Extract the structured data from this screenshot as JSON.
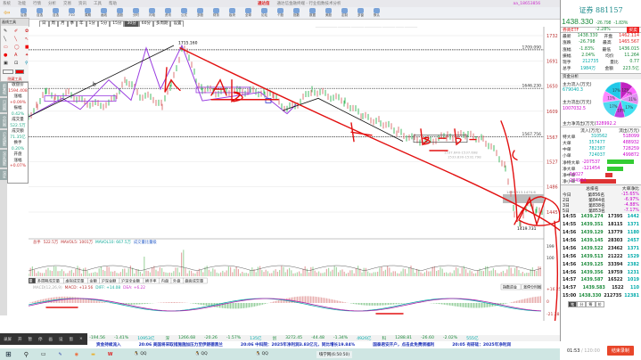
{
  "titlebar": {
    "menus": [
      "系统",
      "功能",
      "行情",
      "分析",
      "交易",
      "资讯",
      "工具",
      "帮助"
    ],
    "brand": "通达信",
    "app_title": "通达信金融终端 - 行业指数技术分析",
    "user": "aa_18653856"
  },
  "toolbar": {
    "items": [
      "后退",
      "自选",
      "自选",
      "F10",
      "周期",
      "画线",
      "选股",
      "分时",
      "闪电",
      "资讯",
      "公式",
      "多股",
      "财务",
      "板块",
      "全球",
      "论坛",
      "个股",
      "指数",
      "数据",
      "美股",
      "定制",
      "多窗",
      "默认"
    ]
  },
  "drawing_tools": {
    "title": "画线工具",
    "footer": "隐藏工具"
  },
  "period_bar": {
    "items": [
      "日",
      "周",
      "月",
      "季",
      "年",
      "1分",
      "5分",
      "15分",
      "30分",
      "60分",
      "多周期",
      "设置"
    ],
    "active": "30分"
  },
  "vertical_tabs": [
    "前复权",
    "日线图",
    "分时图",
    "沪深指数",
    "深证指数",
    "深证"
  ],
  "stats": [
    {
      "label": "收盘价",
      "value": "1594.408"
    },
    {
      "label": "涨幅",
      "value": "+0.09%"
    },
    {
      "label": "振幅",
      "value": "0.42%"
    },
    {
      "label": "成交量",
      "value": "522.5万"
    },
    {
      "label": "成交额",
      "value": "71.35亿"
    },
    {
      "label": "换手",
      "value": "0.20%"
    },
    {
      "label": "开盘",
      "value": ""
    },
    {
      "label": "涨幅",
      "value": "+0.07%"
    }
  ],
  "chart": {
    "top_buttons": [
      "龙头回溯",
      "九转",
      "事件",
      "翻倍选",
      "历K",
      "画",
      "◀▶"
    ],
    "price_axis": [
      "1732",
      "1691",
      "1650",
      "1609",
      "1567",
      "1527",
      "1486",
      "1445"
    ],
    "annotations": {
      "high": "1715.160",
      "line1": "1709.090",
      "line2": "1646.230",
      "line3": "1567.756",
      "low": "1419.731",
      "zone": "1465.513-1474.6",
      "band1": "1537.640-1537.698",
      "band2": "1533.830-1532.798"
    },
    "marks": {
      "b": "b"
    },
    "volume_label": {
      "name": "总手",
      "value": "522.5万",
      "mavol5": "MAVOL5: 1001万",
      "mavol10": "MAVOL10: 667.5万",
      "extra": "成交量比量级"
    },
    "volume_axis": [
      "199",
      "100"
    ],
    "volume_tabs": [
      "成交量",
      "多周期成交量",
      "虚拟成交量",
      "金额",
      "沪深金额",
      "沪深全金额",
      "换手率",
      "内盘",
      "外盘",
      "盘面成交量"
    ],
    "macd_label": {
      "params": "MACD(12,26,9)",
      "macd": "MACD: +13.56",
      "diff": "DIFF: +14.08",
      "dea": "DEA: +6.22"
    },
    "macd_axis": [
      "+16.25",
      "0",
      "-21.38"
    ],
    "macd_buttons": [
      "指数资金",
      "涨停分时图"
    ],
    "dates": [
      "12/12",
      "12/16",
      "12/18",
      "12/22",
      "12/24",
      "12/26",
      "12/30",
      "01/05",
      "01/07",
      "01/09",
      "01/13",
      "01/15",
      "01/19",
      "01/21",
      "01/23",
      "01/27",
      "01/29",
      "02/02",
      "02/04",
      "02/06",
      "02/10",
      "02/12",
      "02/24",
      "02/26",
      "03/02",
      "03/04",
      "03/06",
      "03/10",
      "03/12",
      "03/16",
      "03/18",
      "03/20",
      "03/24",
      "03/26"
    ],
    "indicator_tabs": [
      "指标",
      "常用",
      "主图",
      "MACD",
      "KDJ",
      "RSI",
      "BOLL",
      "W&R",
      "DMI",
      "BIAS",
      "ASI",
      "VR",
      "ARBR",
      "DPO",
      "TRIX",
      "均CMA",
      "BBI",
      "MTM",
      "OBV",
      "SAR",
      "EXPMA编辑"
    ],
    "indicator_active": "MACD",
    "sub_tabs": [
      "朝阳新闻",
      "社区",
      "相关ETF"
    ]
  },
  "quote": {
    "title": "证券 881157",
    "price": "1438.330",
    "change": "-26.798",
    "pct": "-1.83%",
    "etf": "券商ETF",
    "etf_pct": "-2.28%",
    "etf_btn": "买卖",
    "rows": [
      [
        "最新",
        "1438.330",
        "开盘",
        "1462.114"
      ],
      [
        "涨跌",
        "-26.798",
        "最高",
        "1465.567"
      ],
      [
        "涨幅",
        "-1.83%",
        "最低",
        "1436.015"
      ],
      [
        "振幅",
        "2.04%",
        "均价",
        "11.264"
      ],
      [
        "现手",
        "212735",
        "量比",
        "0.77"
      ],
      [
        "总手",
        "1984万",
        "金额",
        "223.5亿"
      ]
    ]
  },
  "funds": {
    "header": "资金分析",
    "inflow_label": "主力流入(万元)",
    "inflow": "679040.3",
    "outflow_label": "主力流出(万元)",
    "outflow": "1007032.5",
    "net_label": "主力净流出(万元)",
    "net": "328992.2",
    "pie": [
      12,
      7,
      11,
      17,
      10,
      17,
      11,
      17
    ],
    "pie_colors": [
      "#c020c0",
      "#ff66ff",
      "#e090f0",
      "#40e0f0",
      "#c040e0",
      "#50d8f0",
      "#ff88ff",
      "#20c8e8"
    ],
    "col_in": "流入(万元)",
    "col_out": "流出(万元)",
    "table": [
      [
        "特大单",
        "310562",
        "518099"
      ],
      [
        "大单",
        "357477",
        "488932"
      ],
      [
        "中单",
        "782387",
        "728259"
      ],
      [
        "小单",
        "724037",
        "499872"
      ]
    ],
    "net_rows": [
      {
        "label": "净特大单",
        "value": "-207537",
        "pct": -0.75
      },
      {
        "label": "净大单",
        "value": "-121454",
        "pct": -0.44
      },
      {
        "label": "净中单",
        "value": "54027",
        "pct": 0.2
      },
      {
        "label": "净小单",
        "value": "274964",
        "pct": 1.0
      }
    ]
  },
  "ranking": {
    "headers": [
      "",
      "总排名",
      "大单净比"
    ],
    "rows": [
      [
        "今日",
        "第856名",
        "-15.65%"
      ],
      [
        "2日",
        "第844名",
        "-6.97%"
      ],
      [
        "3日",
        "第838名",
        "-4.88%"
      ],
      [
        "5日",
        "第853名",
        "-7.17%"
      ]
    ]
  },
  "ticks": [
    [
      "14:55",
      "1439.274",
      "17395",
      "1442"
    ],
    [
      "14:55",
      "1439.351",
      "18115",
      "1371"
    ],
    [
      "14:56",
      "1439.129",
      "13779",
      "1180"
    ],
    [
      "14:56",
      "1439.145",
      "28303",
      "2457"
    ],
    [
      "14:56",
      "1439.522",
      "23462",
      "1371"
    ],
    [
      "14:56",
      "1439.513",
      "21222",
      "1529"
    ],
    [
      "14:56",
      "1439.125",
      "33394",
      "2382"
    ],
    [
      "14:56",
      "1439.356",
      "19759",
      "1231"
    ],
    [
      "14:57",
      "1439.587",
      "16522",
      "1019"
    ],
    [
      "14:57",
      "1439.583",
      "1522",
      "110"
    ],
    [
      "15:00",
      "1438.330",
      "212735",
      "12381"
    ]
  ],
  "tick_tabs": [
    "笔",
    "分",
    "筹",
    "价"
  ],
  "status": [
    [
      "8484亿"
    ],
    [
      "13606.44",
      "-194.56",
      "-1.41%",
      "10953亿"
    ],
    [
      "深",
      "1266.68",
      "-20.26",
      "-1.57%",
      "135亿"
    ],
    [
      "创",
      "3272.45",
      "-44.48",
      "-1.34%",
      "4926亿"
    ],
    [
      "科",
      "1288.81",
      "-26.60",
      "-2.02%",
      "555亿"
    ]
  ],
  "ticker": [
    "资金持续流入",
    "20:06 美国将采取措施施加压力至伊朗德黑兰",
    "20:06 中科院：2025年净利润3.83亿元，同比增长19.84%",
    "国泰君安开户，点击此免费领福利",
    "20:05 有研硅：2025年净利润"
  ],
  "overlay": {
    "label": "录屏",
    "buttons": [
      "开",
      "暂",
      "停",
      "画",
      "设",
      "窗",
      "×"
    ]
  },
  "recording": {
    "elapsed": "01:53",
    "total": "120:00",
    "stop": "结束录制"
  },
  "taskbar": {
    "apps": [
      "QQ",
      "QQ",
      "QQ",
      "嗨学网(6:50:50)"
    ]
  }
}
